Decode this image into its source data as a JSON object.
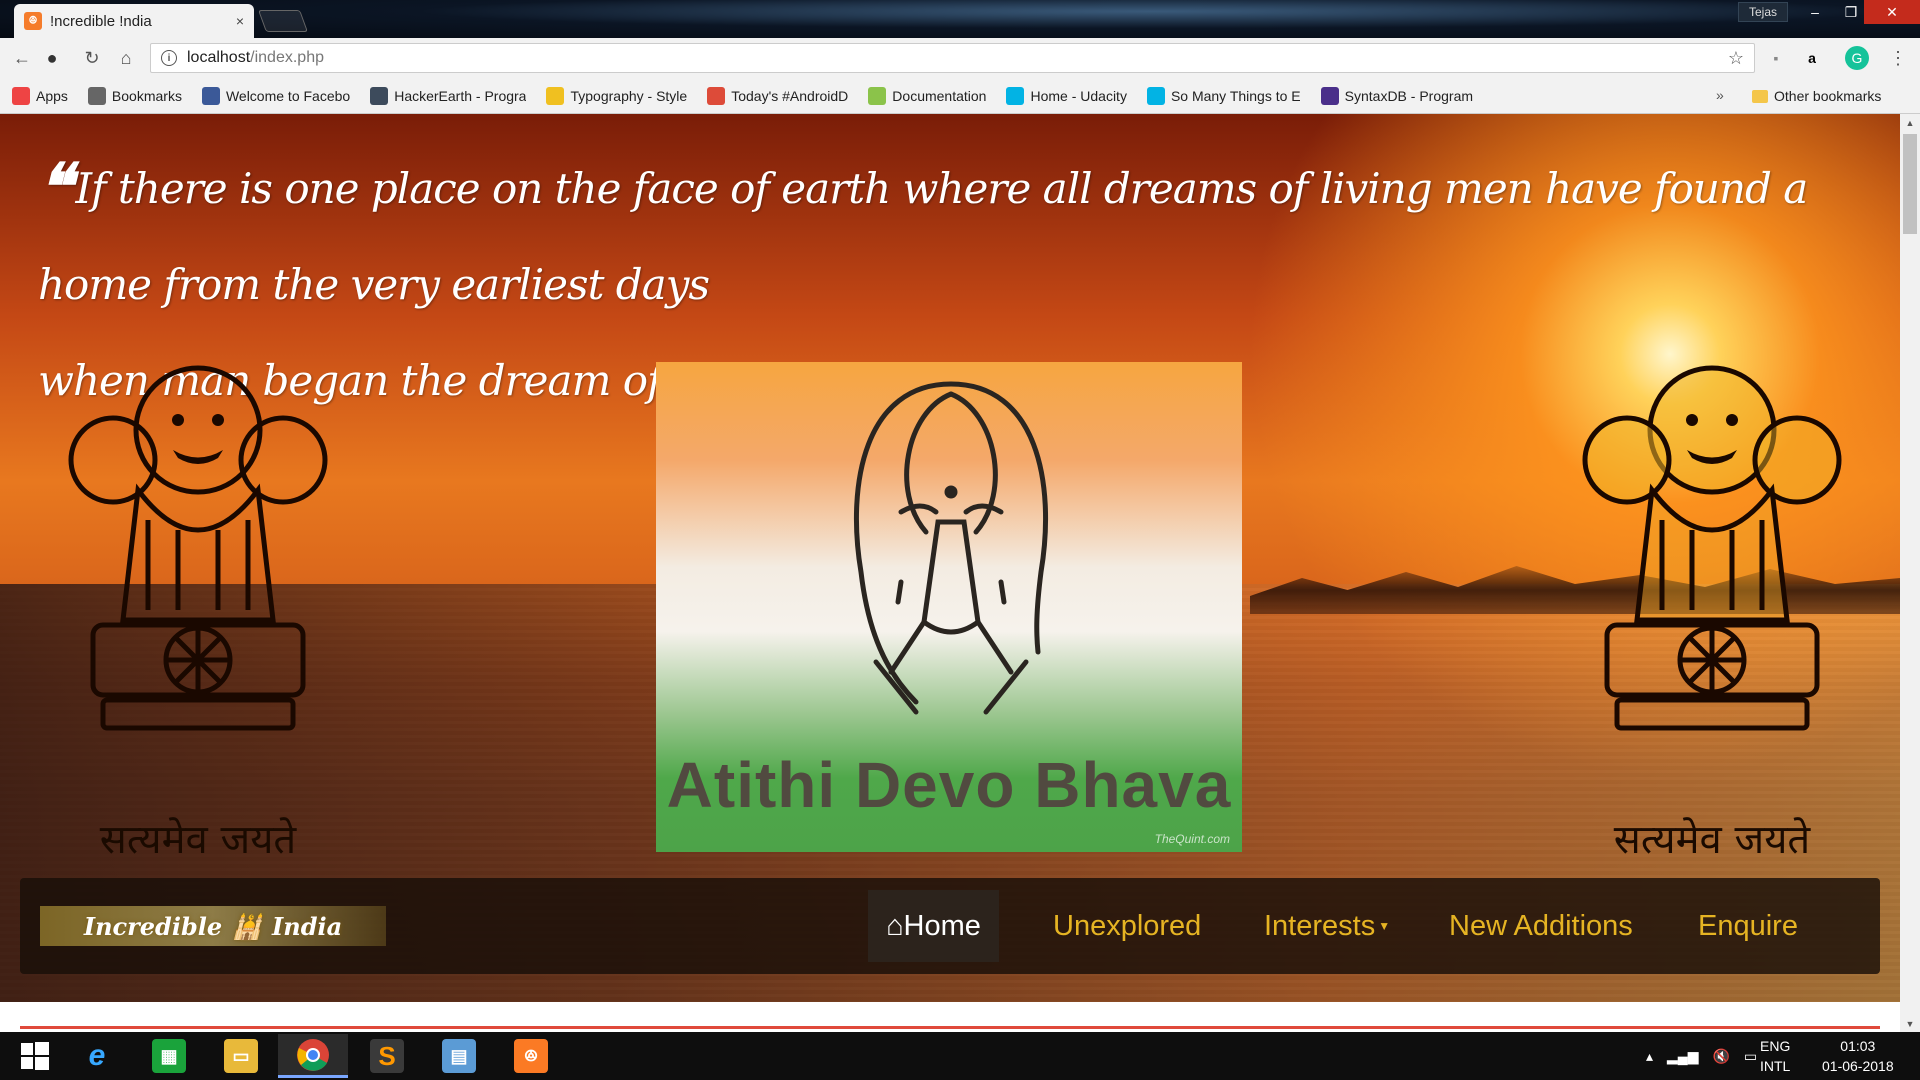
{
  "browser": {
    "tab_title": "!ncredible !ndia",
    "tab_close": "×",
    "profile_name": "Tejas",
    "url_host": "localhost",
    "url_path": "/index.php",
    "bookmarks": [
      {
        "label": "Apps",
        "icon": "apps-grid-icon",
        "color": "#e44"
      },
      {
        "label": "Bookmarks",
        "icon": "star-icon",
        "color": "#666"
      },
      {
        "label": "Welcome to Facebo",
        "icon": "facebook-icon",
        "color": "#3b5998"
      },
      {
        "label": "HackerEarth - Progra",
        "icon": "hackerearth-icon",
        "color": "#3d4b5c"
      },
      {
        "label": "Typography - Style",
        "icon": "typography-icon",
        "color": "#f0c020"
      },
      {
        "label": "Today's #AndroidD",
        "icon": "google-plus-icon",
        "color": "#dd4b39"
      },
      {
        "label": "Documentation",
        "icon": "android-icon",
        "color": "#8bc34a"
      },
      {
        "label": "Home - Udacity",
        "icon": "udacity-icon",
        "color": "#02b3e4"
      },
      {
        "label": "So Many Things to E",
        "icon": "udacity-icon",
        "color": "#02b3e4"
      },
      {
        "label": "SyntaxDB - Program",
        "icon": "syntaxdb-icon",
        "color": "#4a2f8a"
      }
    ],
    "bookmarks_more": "»",
    "other_bookmarks": "Other bookmarks"
  },
  "page": {
    "quote_mark": "❝",
    "quote_line1": "If there is one place on the face of earth where all dreams of living men have found a home from the very earliest days",
    "quote_line2": "when man began the dream of existence, it is India.",
    "motto_left": "सत्यमेव जयते",
    "motto_right": "सत्यमेव जयते",
    "hero_caption": "Atithi Devo Bhava",
    "hero_credit": "TheQuint.com",
    "brand": {
      "left": "Incredible",
      "right": "India"
    },
    "nav": {
      "home": "Home",
      "unexplored": "Unexplored",
      "interests": "Interests",
      "new_additions": "New Additions",
      "enquire": "Enquire"
    },
    "colors": {
      "nav_text": "#e6b423",
      "accent_line": "#e0493b"
    }
  },
  "taskbar": {
    "lang_top": "ENG",
    "lang_bottom": "INTL",
    "time": "01:03",
    "date": "01-06-2018"
  }
}
